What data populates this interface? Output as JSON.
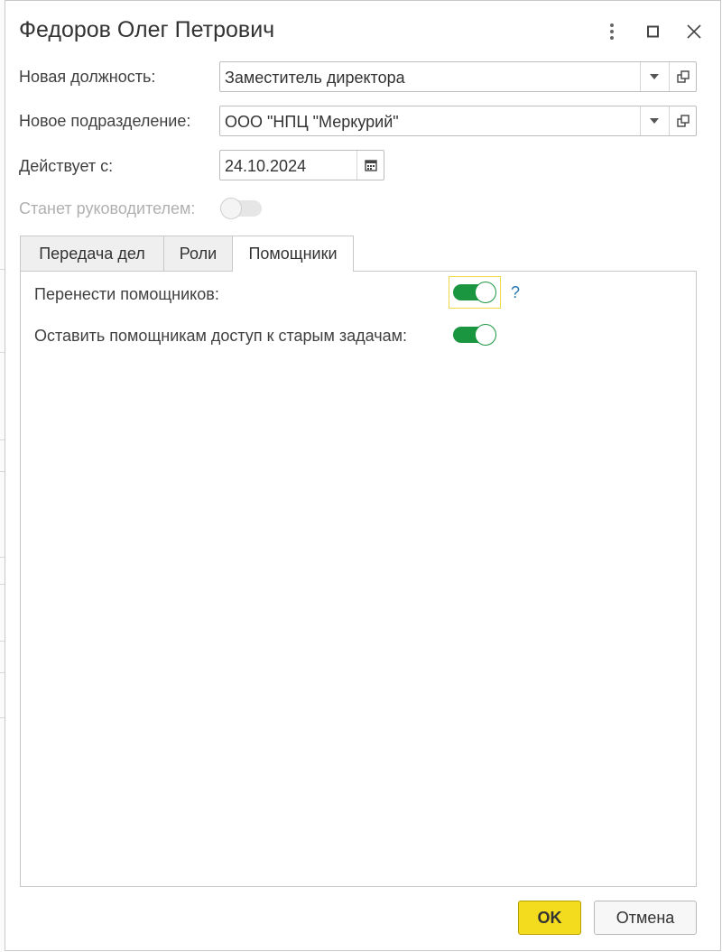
{
  "window": {
    "title": "Федоров Олег Петрович",
    "more_icon": "more-vert-icon",
    "maximize_icon": "maximize-icon",
    "close_icon": "close-icon"
  },
  "form": {
    "position_label": "Новая должность:",
    "position_value": "Заместитель директора",
    "department_label": "Новое подразделение:",
    "department_value": "ООО \"НПЦ \"Меркурий\"",
    "effective_label": "Действует с:",
    "effective_value": "24.10.2024",
    "head_label": "Станет руководителем:",
    "head_toggle_on": false
  },
  "tabs": [
    {
      "label": "Передача дел",
      "active": false
    },
    {
      "label": "Роли",
      "active": false
    },
    {
      "label": "Помощники",
      "active": true
    }
  ],
  "assistants": {
    "transfer_label": "Перенести помощников:",
    "transfer_on": true,
    "help_text": "?",
    "keep_access_label": "Оставить помощникам доступ к старым задачам:",
    "keep_access_on": true
  },
  "buttons": {
    "ok_label": "OK",
    "cancel_label": "Отмена"
  },
  "colors": {
    "toggle_on": "#1a9640",
    "toggle_off": "#e6e6e6",
    "focus_frame": "#f2d94a",
    "ok_button": "#f3dc1e",
    "help": "#2a7ab0"
  }
}
